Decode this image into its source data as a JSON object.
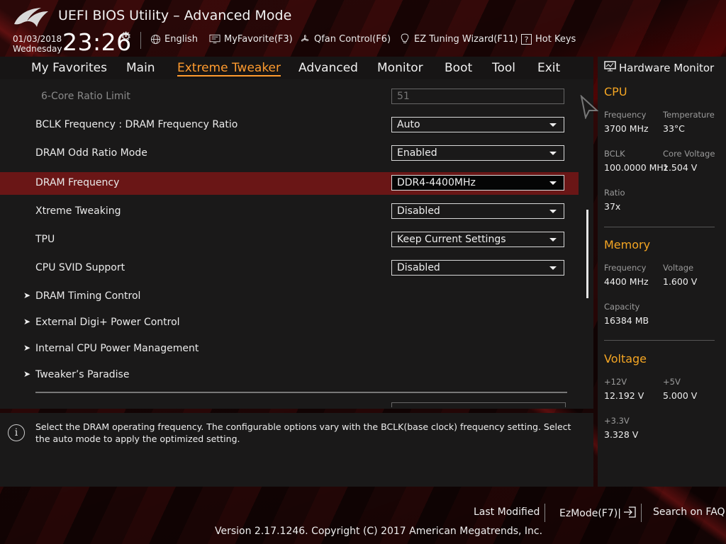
{
  "header": {
    "title": "UEFI BIOS Utility – Advanced Mode",
    "date": "01/03/2018",
    "day": "Wednesday",
    "time": "23:26",
    "toolbar": [
      {
        "icon": "globe-icon",
        "label": "English"
      },
      {
        "icon": "monitor-star-icon",
        "label": "MyFavorite(F3)"
      },
      {
        "icon": "fan-icon",
        "label": "Qfan Control(F6)"
      },
      {
        "icon": "lightbulb-icon",
        "label": "EZ Tuning Wizard(F11)"
      },
      {
        "icon": "question-box-icon",
        "label": "Hot Keys"
      }
    ]
  },
  "nav": {
    "tabs": [
      "My Favorites",
      "Main",
      "Extreme Tweaker",
      "Advanced",
      "Monitor",
      "Boot",
      "Tool",
      "Exit"
    ],
    "active": "Extreme Tweaker"
  },
  "settings": [
    {
      "label": "6-Core Ratio Limit",
      "value": "51",
      "type": "input",
      "disabled": true
    },
    {
      "label": "BCLK Frequency : DRAM Frequency Ratio",
      "value": "Auto",
      "type": "select"
    },
    {
      "label": "DRAM Odd Ratio Mode",
      "value": "Enabled",
      "type": "select"
    },
    {
      "label": "DRAM Frequency",
      "value": "DDR4-4400MHz",
      "type": "select",
      "selected": true
    },
    {
      "label": "Xtreme Tweaking",
      "value": "Disabled",
      "type": "select"
    },
    {
      "label": "TPU",
      "value": "Keep Current Settings",
      "type": "select"
    },
    {
      "label": "CPU SVID Support",
      "value": "Disabled",
      "type": "select"
    }
  ],
  "submenus": [
    "DRAM Timing Control",
    "External Digi+ Power Control",
    "Internal CPU Power Management",
    "Tweaker’s Paradise"
  ],
  "help_text": "Select the DRAM operating frequency. The configurable options vary with the BCLK(base clock) frequency setting. Select the auto mode to apply the optimized setting.",
  "hardware_monitor": {
    "title": "Hardware Monitor",
    "cpu": {
      "title": "CPU",
      "frequency_label": "Frequency",
      "frequency": "3700 MHz",
      "temperature_label": "Temperature",
      "temperature": "33°C",
      "bclk_label": "BCLK",
      "bclk": "100.0000 MHz",
      "core_voltage_label": "Core Voltage",
      "core_voltage": "1.504 V",
      "ratio_label": "Ratio",
      "ratio": "37x"
    },
    "memory": {
      "title": "Memory",
      "frequency_label": "Frequency",
      "frequency": "4400 MHz",
      "voltage_label": "Voltage",
      "voltage": "1.600 V",
      "capacity_label": "Capacity",
      "capacity": "16384 MB"
    },
    "voltage": {
      "title": "Voltage",
      "v12_label": "+12V",
      "v12": "12.192 V",
      "v5_label": "+5V",
      "v5": "5.000 V",
      "v33_label": "+3.3V",
      "v33": "3.328 V"
    }
  },
  "footer": {
    "last_modified": "Last Modified",
    "ezmode": "EzMode(F7)|",
    "search_faq": "Search on FAQ",
    "copyright": "Version 2.17.1246. Copyright (C) 2017 American Megatrends, Inc."
  },
  "colors": {
    "accent": "#f5a623",
    "active_tab": "#ff9b2e",
    "highlight_row": "#6a1616",
    "panel": "#1a1919"
  }
}
